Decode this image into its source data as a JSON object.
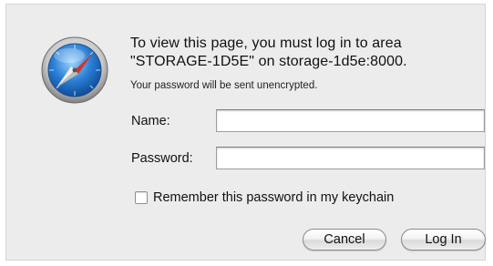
{
  "dialog": {
    "app_icon": "safari-compass-icon",
    "message_line1": "To view this page, you must log in to area",
    "message_line2": "\"STORAGE-1D5E\" on storage-1d5e:8000.",
    "note": "Your password will be sent unencrypted.",
    "name_label": "Name:",
    "name_value": "",
    "password_label": "Password:",
    "password_value": "",
    "remember_label": "Remember this password in my keychain",
    "remember_checked": false,
    "cancel_label": "Cancel",
    "login_label": "Log In"
  },
  "colors": {
    "sheet_background": "#ececec",
    "compass_blue": "#2a7fd4",
    "needle_red": "#d8322a"
  }
}
